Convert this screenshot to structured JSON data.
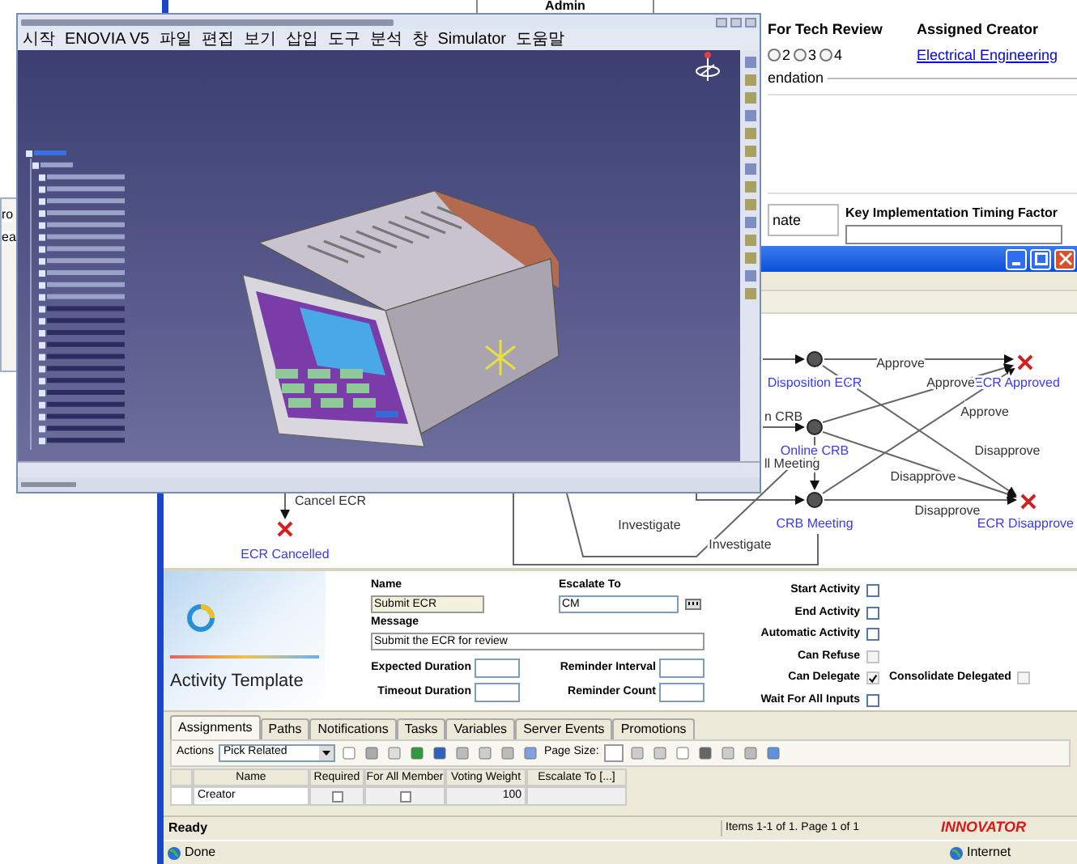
{
  "background_window": {
    "fragments": [
      "ro",
      "ea"
    ]
  },
  "form_window": {
    "header": "Admin",
    "tech_review": {
      "label": "For Tech Review",
      "options": [
        {
          "label": "2",
          "selected": false
        },
        {
          "label": "3",
          "selected": false
        },
        {
          "label": "4",
          "selected": false
        }
      ]
    },
    "assigned_creator": {
      "label": "Assigned Creator",
      "value": "Electrical Engineering"
    },
    "group_label": "endation",
    "field_label": "nate",
    "timing_label": "Key Implementation Timing Factor"
  },
  "cad_window": {
    "menu": [
      "시작",
      "ENOVIA V5",
      "파일",
      "편집",
      "보기",
      "삽입",
      "도구",
      "분석",
      "창",
      "Simulator",
      "도움말"
    ]
  },
  "workflow_window": {
    "diagram": {
      "nodes": [
        {
          "label": "Disposition ECR",
          "kind": "activity"
        },
        {
          "label": "Online CRB",
          "kind": "activity"
        },
        {
          "label": "CRB Meeting",
          "kind": "activity"
        },
        {
          "label": "ECR Approved",
          "kind": "end"
        },
        {
          "label": "ECR Disapprove",
          "kind": "end"
        },
        {
          "label": "ECR Cancelled",
          "kind": "end"
        }
      ],
      "edge_labels": [
        "Approve",
        "Approve",
        "Approve",
        "Disapprove",
        "Disapprove",
        "Disapprove",
        "Investigate",
        "Investigate",
        "n CRB",
        "ll Meeting",
        "Cancel ECR"
      ]
    },
    "activity": {
      "title": "Activity Template",
      "name": {
        "label": "Name",
        "value": "Submit ECR"
      },
      "escalate_to": {
        "label": "Escalate To",
        "value": "CM"
      },
      "message": {
        "label": "Message",
        "value": "Submit the ECR for review"
      },
      "durations": [
        {
          "label": "Expected Duration"
        },
        {
          "label": "Reminder Interval"
        },
        {
          "label": "Timeout Duration"
        },
        {
          "label": "Reminder Count"
        }
      ],
      "options": [
        {
          "label": "Start Activity",
          "checked": false,
          "disabled": false
        },
        {
          "label": "End Activity",
          "checked": false,
          "disabled": false
        },
        {
          "label": "Automatic Activity",
          "checked": false,
          "disabled": false
        },
        {
          "label": "Can Refuse",
          "checked": false,
          "disabled": true
        },
        {
          "label": "Can Delegate",
          "checked": true,
          "disabled": true
        },
        {
          "label": "Wait For All Inputs",
          "checked": false,
          "disabled": false
        }
      ],
      "consolidate": {
        "label": "Consolidate Delegated",
        "checked": false,
        "disabled": true
      }
    },
    "tabs": [
      {
        "label": "Assignments",
        "selected": true
      },
      {
        "label": "Paths",
        "selected": false
      },
      {
        "label": "Notifications",
        "selected": false
      },
      {
        "label": "Tasks",
        "selected": false
      },
      {
        "label": "Variables",
        "selected": false
      },
      {
        "label": "Server Events",
        "selected": false
      },
      {
        "label": "Promotions",
        "selected": false
      }
    ],
    "toolbar": {
      "actions_label": "Actions",
      "action_select": "Pick Related",
      "page_size_label": "Page Size:"
    },
    "table": {
      "columns": [
        "Name",
        "Required",
        "For All Member",
        "Voting Weight",
        "Escalate To [...]"
      ],
      "rows": [
        {
          "name": "Creator",
          "required": false,
          "for_all_member": false,
          "voting_weight": "100"
        }
      ]
    },
    "status_bar": {
      "state": "Ready",
      "paging": "Items 1-1 of 1. Page 1 of 1",
      "logo": "INNOVATOR"
    },
    "browser_status": {
      "state": "Done",
      "zone": "Internet"
    }
  }
}
